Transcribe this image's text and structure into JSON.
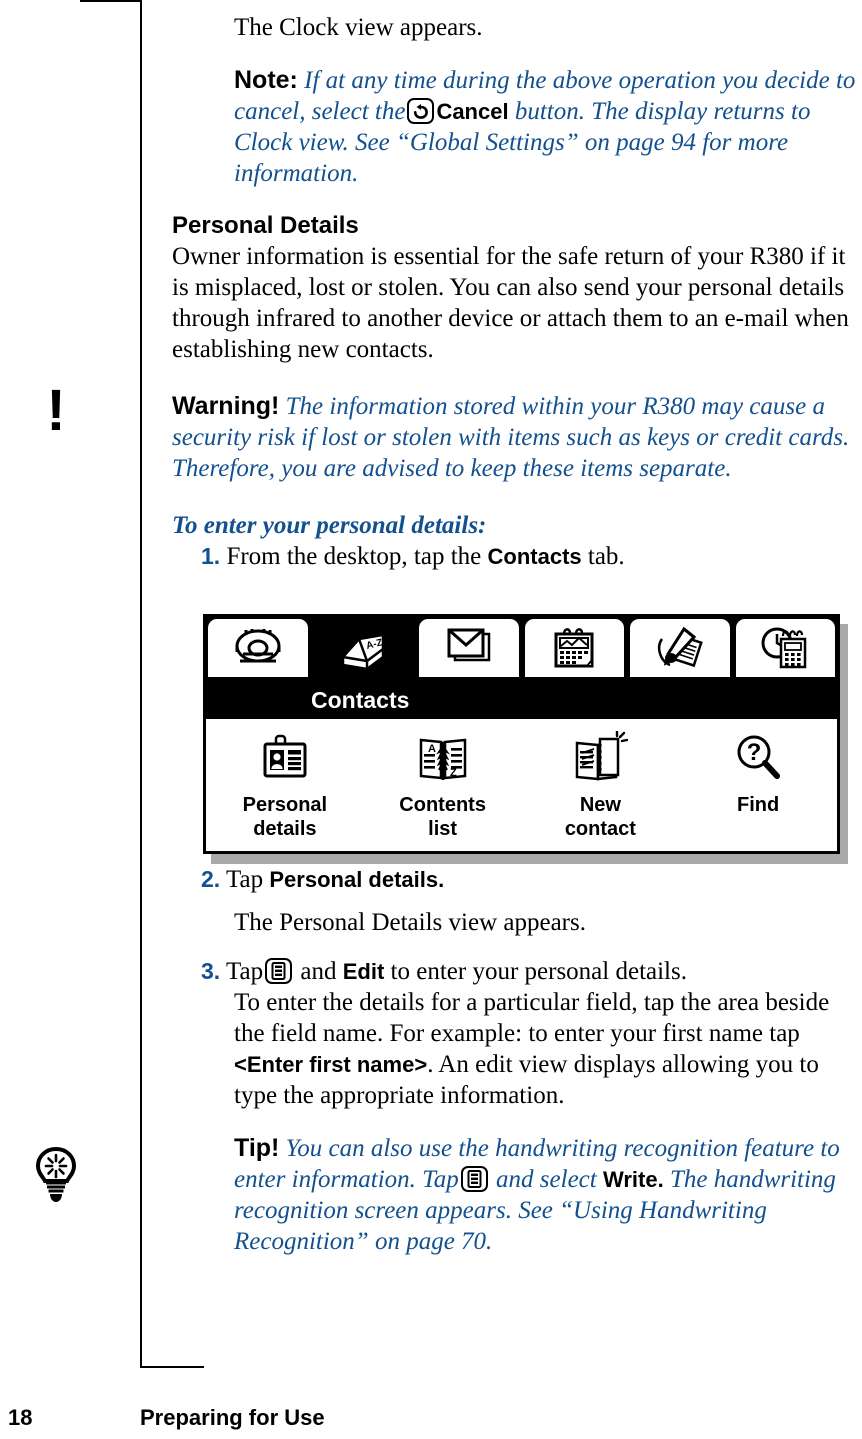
{
  "page": {
    "number": "18",
    "section_title": "Preparing for Use"
  },
  "body": {
    "intro_line": "The Clock view appears.",
    "note": {
      "lead": "Note:",
      "text_before_icon": "If at any time during the above operation you decide to cancel, select the",
      "icon": "cancel-return-icon",
      "button_label": "Cancel",
      "text_after_icon": "button. The display returns to Clock view. See “Global Settings” on page 94 for more information."
    },
    "section_heading": "Personal Details",
    "section_paragraph": "Owner information is essential for the safe return of your R380 if it is misplaced, lost or stolen. You can also send your personal details through infrared to another device or attach them to an e-mail when establishing new contacts.",
    "warning": {
      "margin_icon": "exclamation-icon",
      "lead": "Warning!",
      "text": "The information stored within your R380 may cause a security risk if lost or stolen with items such as keys or credit cards. Therefore, you are advised to keep these items separate."
    },
    "procedure_title": "To enter your personal details:",
    "steps": [
      {
        "number": "1.",
        "text_before_bold": "From the desktop, tap the",
        "bold": "Contacts",
        "text_after_bold": "tab."
      },
      {
        "number": "2.",
        "text_before_bold": "Tap",
        "bold": "Personal details.",
        "text_after_bold": "",
        "follow_up": "The Personal Details view appears."
      },
      {
        "number": "3.",
        "text_before_icon": "Tap",
        "icon": "menu-list-icon",
        "text_mid": "and",
        "bold": "Edit",
        "text_after_bold": "to enter your personal details.",
        "follow_up_before_bold": "To enter the details for a particular field, tap the area beside the field name. For example: to enter your first name tap",
        "follow_up_bold": "<Enter first name>",
        "follow_up_after_bold": ". An edit view displays allowing you to type the appropriate information."
      }
    ],
    "tip": {
      "margin_icon": "lightbulb-icon",
      "lead": "Tip!",
      "text_before_icon": "You can also use the handwriting recognition feature to enter information. Tap",
      "icon": "menu-list-icon",
      "text_mid": "and select",
      "bold": "Write.",
      "text_after_bold": "The handwriting recognition screen appears. See “Using Handwriting Recognition” on page 70."
    }
  },
  "figure": {
    "caption_bar_label": "Contacts",
    "tabs": [
      {
        "name": "phone-tab",
        "icon": "telephone-icon",
        "selected": false
      },
      {
        "name": "contacts-tab",
        "icon": "address-book-az-icon",
        "selected": true
      },
      {
        "name": "messages-tab",
        "icon": "envelope-icon",
        "selected": false
      },
      {
        "name": "calendar-tab",
        "icon": "calendar-notepad-icon",
        "selected": false
      },
      {
        "name": "notes-tab",
        "icon": "pen-notepad-icon",
        "selected": false
      },
      {
        "name": "extras-tab",
        "icon": "clock-calculator-icon",
        "selected": false
      }
    ],
    "apps": [
      {
        "name": "personal-details-app",
        "icon": "id-card-icon",
        "label_line1": "Personal",
        "label_line2": "details"
      },
      {
        "name": "contents-list-app",
        "icon": "open-book-az-icon",
        "label_line1": "Contents",
        "label_line2": "list"
      },
      {
        "name": "new-contact-app",
        "icon": "new-contact-icon",
        "label_line1": "New",
        "label_line2": "contact"
      },
      {
        "name": "find-app",
        "icon": "magnifier-question-icon",
        "label_line1": "Find",
        "label_line2": ""
      }
    ]
  },
  "colors": {
    "accent_blue": "#12508f",
    "black": "#000000",
    "shadow_gray": "#a8a8a8"
  }
}
